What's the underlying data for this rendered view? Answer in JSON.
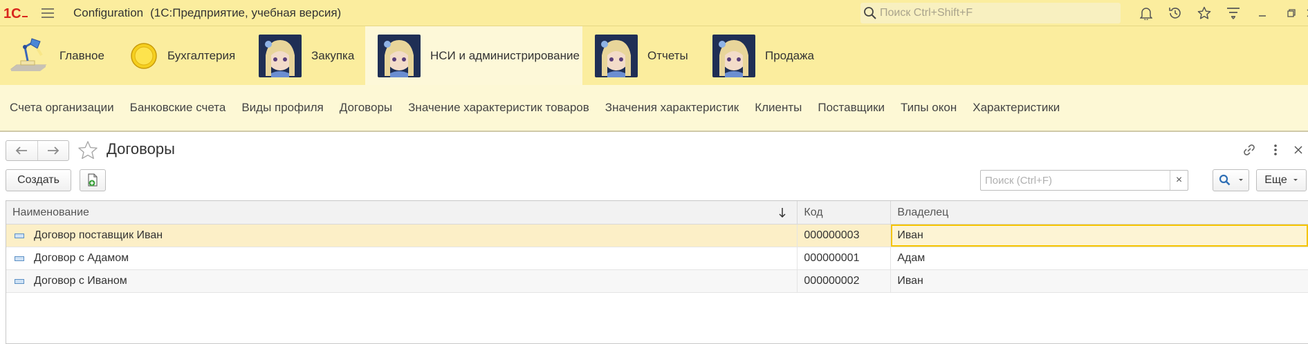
{
  "titlebar": {
    "app_name": "Configuration",
    "app_subtitle": "(1С:Предприятие, учебная версия)",
    "search_placeholder": "Поиск Ctrl+Shift+F"
  },
  "sections": [
    {
      "label": "Главное",
      "icon": "desk-lamp-icon"
    },
    {
      "label": "Бухгалтерия",
      "icon": "coin-icon"
    },
    {
      "label": "Закупка",
      "icon": "anime-avatar-image"
    },
    {
      "label": "НСИ и администрирование",
      "icon": "anime-avatar-image",
      "active": true
    },
    {
      "label": "Отчеты",
      "icon": "anime-avatar-image"
    },
    {
      "label": "Продажа",
      "icon": "anime-avatar-image"
    }
  ],
  "commands": [
    "Счета организации",
    "Банковские счета",
    "Виды профиля",
    "Договоры",
    "Значение характеристик товаров",
    "Значения характеристик",
    "Клиенты",
    "Поставщики",
    "Типы окон",
    "Характеристики"
  ],
  "form": {
    "title": "Договоры",
    "create_label": "Создать",
    "search_placeholder": "Поиск (Ctrl+F)",
    "clear_label": "×",
    "more_label": "Еще"
  },
  "table": {
    "columns": [
      "Наименование",
      "Код",
      "Владелец"
    ],
    "rows": [
      {
        "name": "Договор поставщик Иван",
        "code": "000000003",
        "owner": "Иван"
      },
      {
        "name": "Договор с Адамом",
        "code": "000000001",
        "owner": "Адам"
      },
      {
        "name": "Договор с Иваном",
        "code": "000000002",
        "owner": "Иван"
      }
    ]
  },
  "colors": {
    "header_bg": "#fbed9e",
    "commands_bg": "#fdf8d5",
    "brand_red": "#d9261c",
    "selection": "#f5c400"
  }
}
